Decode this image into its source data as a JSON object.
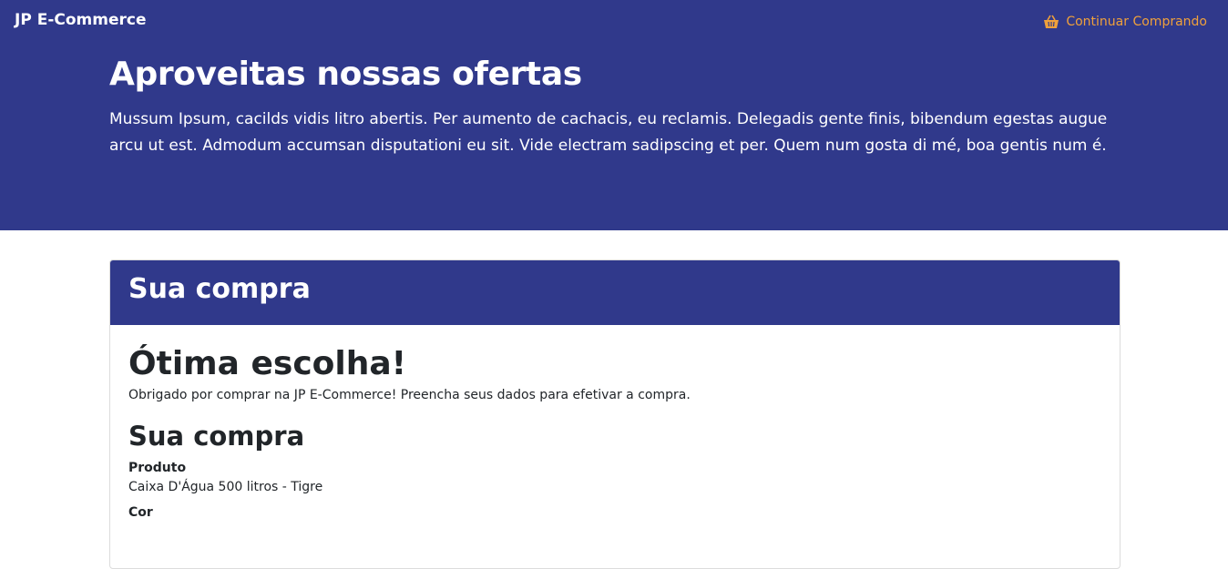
{
  "navbar": {
    "brand": "JP E-Commerce",
    "continue_label": "Continuar Comprando",
    "continue_icon": "basket-icon",
    "accent_color": "#f0a13b"
  },
  "hero": {
    "title": "Aproveitas nossas ofertas",
    "text": "Mussum Ipsum, cacilds vidis litro abertis. Per aumento de cachacis, eu reclamis. Delegadis gente finis, bibendum egestas augue arcu ut est. Admodum accumsan disputationi eu sit. Vide electram sadipscing et per. Quem num gosta di mé, boa gentis num é.",
    "background_color": "#30398b"
  },
  "card": {
    "header_title": "Sua compra",
    "heading": "Ótima escolha!",
    "intro": "Obrigado por comprar na JP E-Commerce! Preencha seus dados para efetivar a compra.",
    "section_title": "Sua compra",
    "fields": [
      {
        "label": "Produto",
        "value": "Caixa D'Água 500 litros - Tigre"
      },
      {
        "label": "Cor",
        "value": ""
      }
    ]
  }
}
